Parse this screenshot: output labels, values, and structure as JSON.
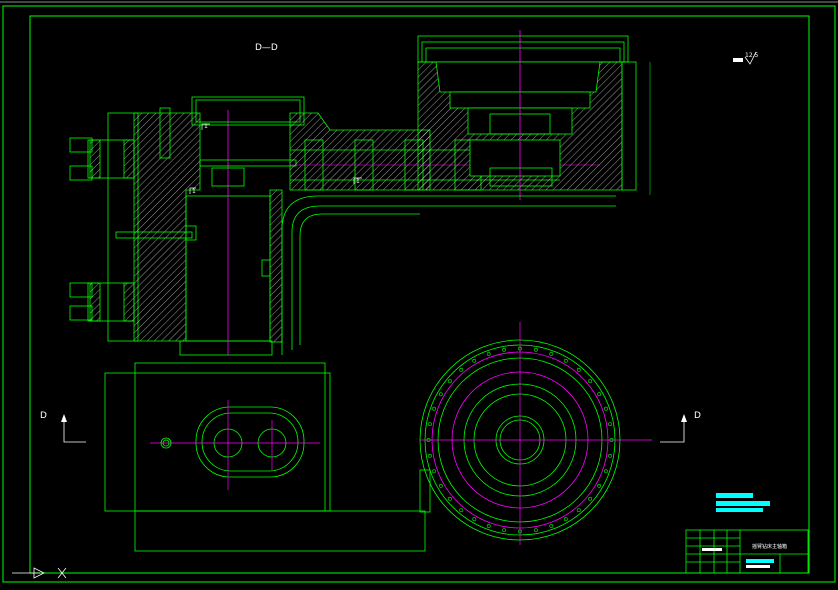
{
  "section_title": "D—D",
  "section_marker_left": "D",
  "section_marker_right": "D",
  "roughness_note": "12.5",
  "section_callouts": [
    "1",
    "1",
    "1"
  ],
  "title_block": {
    "drawing_name": "摇臂钻床主轴箱"
  },
  "colors": {
    "background": "#000000",
    "outline": "#00ff00",
    "center_line": "#ff00ff",
    "text": "#ffffff",
    "highlight": "#00ffff"
  }
}
